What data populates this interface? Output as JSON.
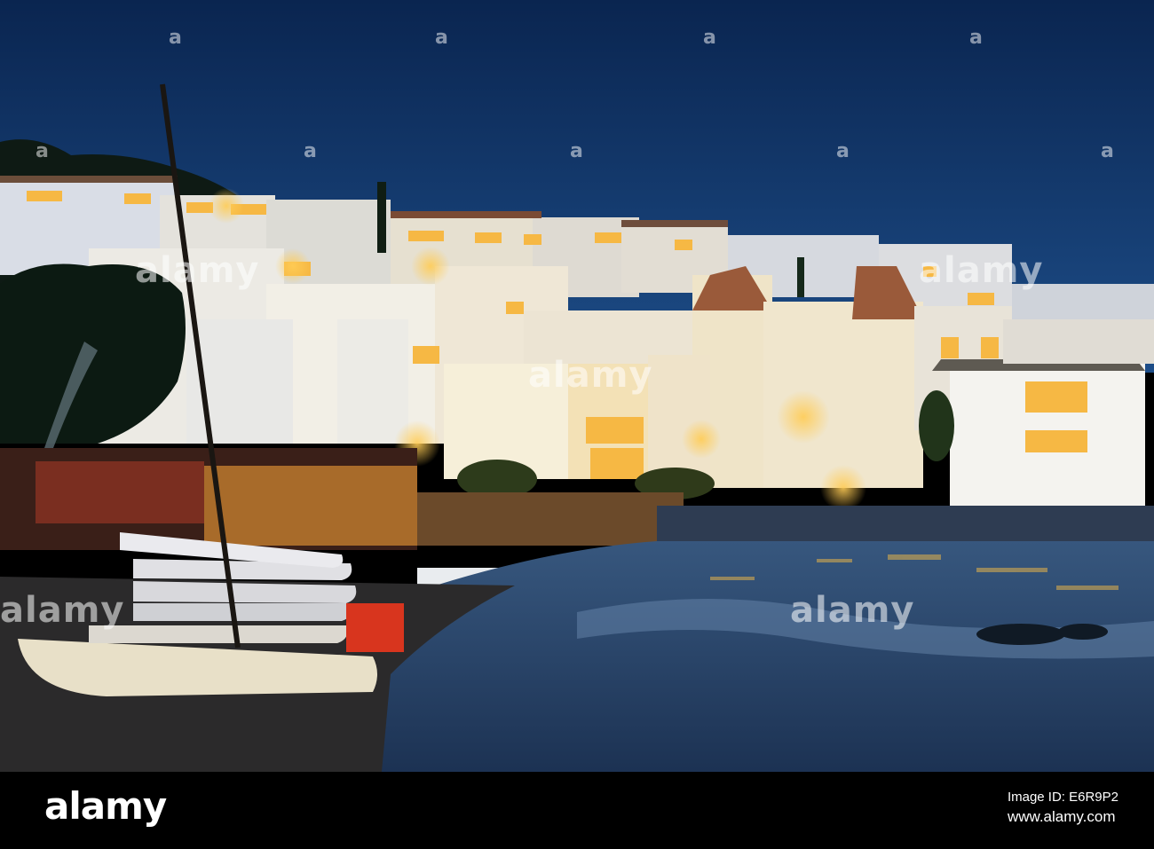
{
  "watermark": {
    "text": "alamy",
    "dot_glyph": "a"
  },
  "footer": {
    "logo_text": "alamy",
    "image_id_label": "Image ID: E6R9P2",
    "url": "www.alamy.com"
  },
  "colors": {
    "sky_top": "#0b2a5a",
    "sky_bottom": "#1b4b86",
    "water": "#2a4e78",
    "lights": "#f2b23a",
    "footer_bg": "#000000"
  }
}
